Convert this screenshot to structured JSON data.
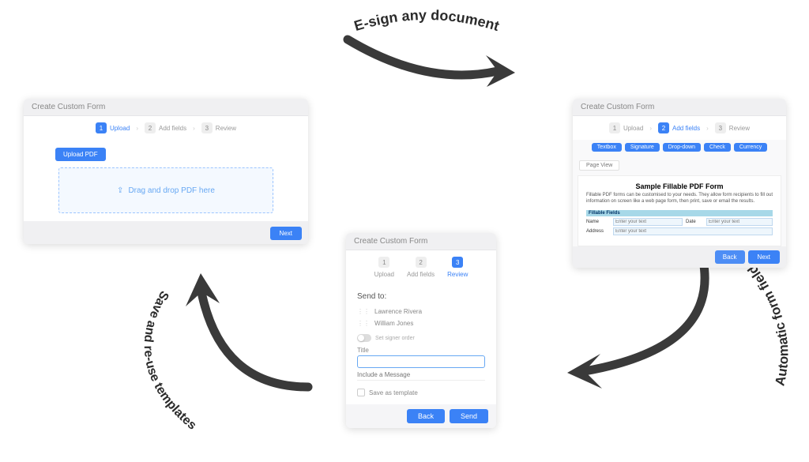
{
  "labels": {
    "top": "E-sign any document",
    "right": "Automatic form fields",
    "left": "Save and re-use templates"
  },
  "cards": {
    "upload": {
      "title": "Create Custom Form",
      "steps": [
        "Upload",
        "Add fields",
        "Review"
      ],
      "upload_btn": "Upload PDF",
      "dropzone": "Drag and drop PDF here",
      "next": "Next"
    },
    "fields": {
      "title": "Create Custom Form",
      "steps": [
        "Upload",
        "Add fields",
        "Review"
      ],
      "field_types": [
        "Textbox",
        "Signature",
        "Drop-down",
        "Check",
        "Currency"
      ],
      "page_chip": "Page View",
      "pdf_title": "Sample Fillable PDF Form",
      "pdf_desc": "Fillable PDF forms can be customised to your needs. They allow form recipients to fill out information on screen like a web page form, then print, save or email the results.",
      "fillable_header": "Fillable Fields",
      "rows": {
        "name_label": "Name",
        "name_ph": "Enter your text",
        "date_label": "Date",
        "date_ph": "Enter your text",
        "addr_label": "Address",
        "addr_ph": "Enter your text"
      },
      "back": "Back",
      "next": "Next"
    },
    "review": {
      "title": "Create Custom Form",
      "steps": [
        "Upload",
        "Add fields",
        "Review"
      ],
      "send_to": "Send to:",
      "recipients": [
        "Lawrence Rivera",
        "William Jones"
      ],
      "signer_order": "Set signer order",
      "title_label": "Title",
      "message_ph": "Include a Message",
      "save_template": "Save as template",
      "back": "Back",
      "send": "Send"
    }
  }
}
